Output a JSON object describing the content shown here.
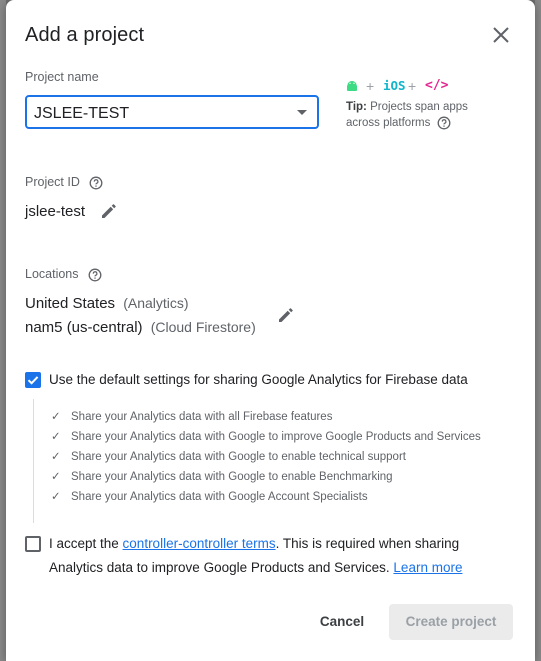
{
  "dialog": {
    "title": "Add a project"
  },
  "project_name": {
    "label": "Project name",
    "value": "JSLEE-TEST"
  },
  "platforms": {
    "ios_label": "iOS",
    "code_label": "</>",
    "plus": "+",
    "tip_bold": "Tip:",
    "tip_text": "Projects span apps across platforms"
  },
  "project_id": {
    "label": "Project ID",
    "value": "jslee-test"
  },
  "locations": {
    "label": "Locations",
    "analytics_location": "United States",
    "analytics_suffix": "(Analytics)",
    "firestore_location": "nam5 (us-central)",
    "firestore_suffix": "(Cloud Firestore)"
  },
  "analytics_default": {
    "checked": true,
    "label": "Use the default settings for sharing Google Analytics for Firebase data"
  },
  "sharing_items": [
    "Share your Analytics data with all Firebase features",
    "Share your Analytics data with Google to improve Google Products and Services",
    "Share your Analytics data with Google to enable technical support",
    "Share your Analytics data with Google to enable Benchmarking",
    "Share your Analytics data with Google Account Specialists"
  ],
  "terms": {
    "checked": false,
    "prefix": "I accept the ",
    "link_text": "controller-controller terms",
    "middle": ". This is required when sharing",
    "line2": "Analytics data to improve Google Products and Services. ",
    "learn_more": "Learn more"
  },
  "actions": {
    "cancel": "Cancel",
    "create": "Create project"
  },
  "colors": {
    "accent": "#1a73e8",
    "android": "#3ddc84",
    "ios": "#12b5cb",
    "web": "#e52592"
  }
}
